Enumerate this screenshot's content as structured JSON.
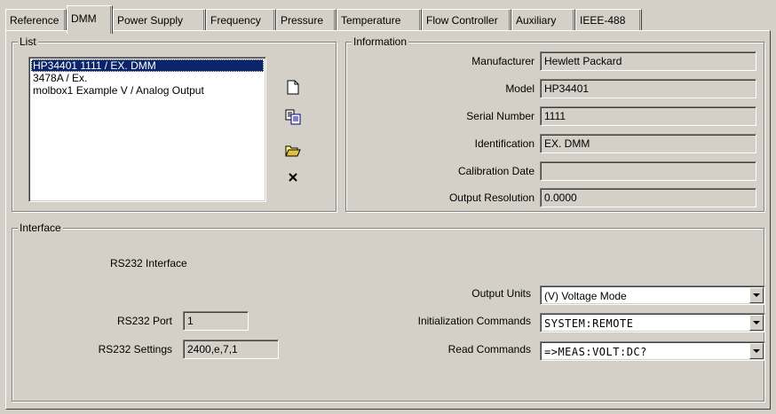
{
  "tabs": [
    {
      "label": "Reference"
    },
    {
      "label": "DMM"
    },
    {
      "label": "Power Supply"
    },
    {
      "label": "Frequency"
    },
    {
      "label": "Pressure"
    },
    {
      "label": "Temperature"
    },
    {
      "label": "Flow Controller"
    },
    {
      "label": "Auxiliary"
    },
    {
      "label": "IEEE-488"
    }
  ],
  "active_tab": "DMM",
  "list": {
    "title": "List",
    "items": [
      {
        "label": "HP34401 1111 / EX. DMM",
        "selected": true
      },
      {
        "label": "3478A  / Ex."
      },
      {
        "label": "molbox1 Example V / Analog Output"
      }
    ],
    "icons": [
      "new-document-icon",
      "copy-icon",
      "open-folder-icon",
      "delete-icon"
    ]
  },
  "information": {
    "title": "Information",
    "fields": [
      {
        "label": "Manufacturer",
        "value": "Hewlett Packard"
      },
      {
        "label": "Model",
        "value": "HP34401"
      },
      {
        "label": "Serial Number",
        "value": "1111"
      },
      {
        "label": "Identification",
        "value": "EX. DMM"
      },
      {
        "label": "Calibration Date",
        "value": ""
      },
      {
        "label": "Output Resolution",
        "value": "0.0000"
      }
    ]
  },
  "interface": {
    "title": "Interface",
    "rs232_heading": "RS232 Interface",
    "rs232_port_label": "RS232 Port",
    "rs232_port_value": "1",
    "rs232_settings_label": "RS232 Settings",
    "rs232_settings_value": "2400,e,7,1",
    "output_units_label": "Output Units",
    "output_units_value": "(V) Voltage Mode",
    "init_commands_label": "Initialization Commands",
    "init_commands_value": "SYSTEM:REMOTE",
    "read_commands_label": "Read Commands",
    "read_commands_value": "=>MEAS:VOLT:DC?"
  }
}
